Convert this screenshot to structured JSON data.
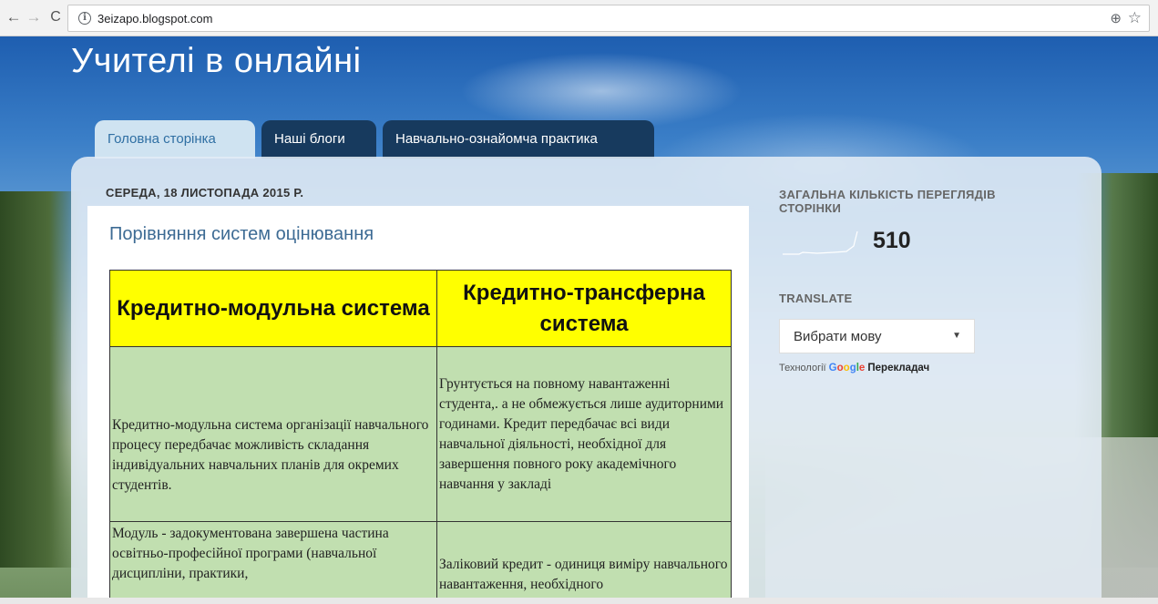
{
  "browser": {
    "back": "←",
    "forward": "→",
    "reload": "C",
    "info": "i",
    "url": "3eizapo.blogspot.com",
    "zoom": "⊕",
    "star": "☆"
  },
  "blog": {
    "title": "Учителі в онлайні"
  },
  "tabs": [
    {
      "label": "Головна сторінка",
      "active": true
    },
    {
      "label": "Наші блоги",
      "active": false
    },
    {
      "label": "Навчально-ознайомча практика",
      "active": false
    }
  ],
  "post": {
    "date": "СЕРЕДА, 18 ЛИСТОПАДА 2015 Р.",
    "title": "Порівняння систем оцінювання",
    "table": {
      "headers": [
        "Кредитно-модульна система",
        "Кредитно-трансферна система"
      ],
      "rows": [
        [
          "Кредитно-модульна система організації навчального процесу передбачає можливість складання індивідуальних навчальних планів для окремих студентів.",
          "Грунтується на повному навантаженні студента,. а не обмежується лише аудиторними годинами. Кредит передбачає всі види навчальної діяльності, необхідної для завершення повного року академічного навчання у закладі"
        ],
        [
          "Модуль - задокументована завершена частина освітньо-професійної програми (навчальної дисципліни, практики,",
          "Заліковий кредит - одиниця виміру навчального навантаження, необхідного"
        ]
      ]
    }
  },
  "sidebar": {
    "views_heading": "ЗАГАЛЬНА КІЛЬКІСТЬ ПЕРЕГЛЯДІВ СТОРІНКИ",
    "views_count": "510",
    "translate_heading": "TRANSLATE",
    "select_value": "Вибрати мову",
    "select_arrow": "▼",
    "powered_prefix": "Технології",
    "google": [
      "G",
      "o",
      "o",
      "g",
      "l",
      "e"
    ],
    "translate_link": "Перекладач"
  },
  "colors": {
    "header_yellow": "#ffff00",
    "cell_green": "#c1dfb0",
    "tab_dark": "#173a5e",
    "tab_active": "#cfe3f1",
    "title_blue": "#3d6b94"
  }
}
